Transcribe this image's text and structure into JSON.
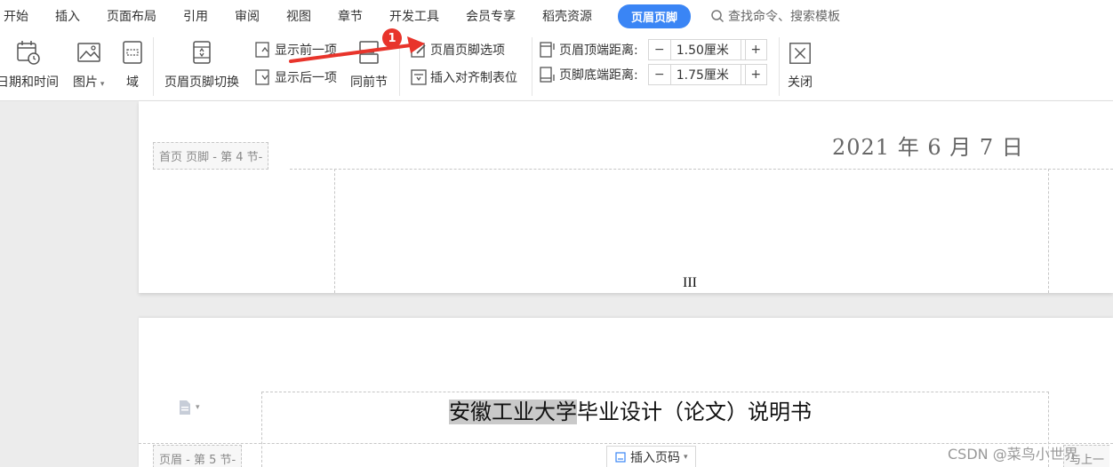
{
  "menu": {
    "items": [
      "开始",
      "插入",
      "页面布局",
      "引用",
      "审阅",
      "视图",
      "章节",
      "开发工具",
      "会员专享",
      "稻壳资源"
    ],
    "active": "页眉页脚",
    "search": "查找命令、搜索模板"
  },
  "ribbon": {
    "datetime": "日期和时间",
    "picture": "图片",
    "field": "域",
    "switch": "页眉页脚切换",
    "show_prev": "显示前一项",
    "show_next": "显示后一项",
    "same_as_prev": "同前节",
    "options": "页眉页脚选项",
    "insert_tab": "插入对齐制表位",
    "header_top_label": "页眉顶端距离:",
    "header_top_value": "1.50厘米",
    "footer_bottom_label": "页脚底端距离:",
    "footer_bottom_value": "1.75厘米",
    "minus": "−",
    "plus": "+",
    "close": "关闭"
  },
  "annotation": {
    "badge": "1"
  },
  "document": {
    "footer_tag": "首页 页脚  - 第 4 节-",
    "date": "2021 年 6 月 7 日",
    "page_number": "III",
    "header_highlight": "安徽工业大学",
    "header_rest": "毕业设计（论文）说明书",
    "header_tag": "页眉  - 第 5 节-",
    "insert_page_number": "插入页码",
    "right_tag": "与上一"
  },
  "watermark": "CSDN @菜鸟小世界"
}
